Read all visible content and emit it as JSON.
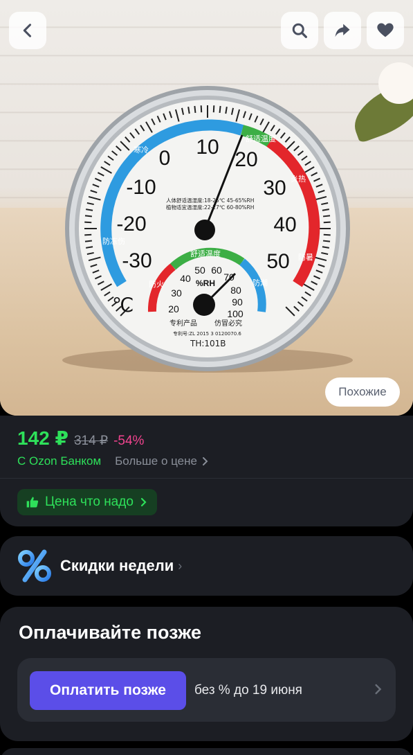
{
  "header": {
    "back_icon": "chevron-left-icon",
    "search_icon": "search-icon",
    "share_icon": "share-arrow-icon",
    "like_icon": "heart-icon"
  },
  "product_image": {
    "alt": "thermometer-hygrometer",
    "similar_label": "Похожие",
    "dial": {
      "temp_left": [
        "0",
        "-10",
        "-20",
        "-30"
      ],
      "temp_right": [
        "10",
        "20",
        "30",
        "40",
        "50"
      ],
      "unit": "℃",
      "humidity_scale": [
        "20",
        "30",
        "40",
        "50",
        "60",
        "70",
        "80",
        "90",
        "100"
      ],
      "humidity_unit": "%RH",
      "comfort_text": "舒适温度",
      "model": "TH:101B",
      "small_line_1": "人体舒适温湿度:18-25℃ 45-65%RH",
      "small_line_2": "植物适宜温湿度:22-27℃ 60-80%RH",
      "label_cold": "寒冷",
      "label_freeze": "防冻伤",
      "label_hot": "炎热",
      "label_heat": "防暑",
      "label_fire": "防火",
      "label_damp": "防潮",
      "brand_line": "专利产品",
      "brand_line2": "仿冒必究",
      "patent": "专利号:ZL 2015 3 0120070.6"
    }
  },
  "price": {
    "current": "142 ₽",
    "old": "314 ₽",
    "discount": "-54%",
    "bank_label": "С Ozon Банком",
    "more_label": "Больше о цене",
    "badge_label": "Цена что надо"
  },
  "promo": {
    "title": "Скидки недели"
  },
  "pay_later": {
    "title": "Оплачивайте позже",
    "button_label": "Оплатить позже",
    "terms": "без % до 19 июня"
  },
  "colors": {
    "green": "#2ee05a",
    "pink": "#f2448f",
    "purple": "#5b4ee8",
    "card": "#1c1e24"
  }
}
